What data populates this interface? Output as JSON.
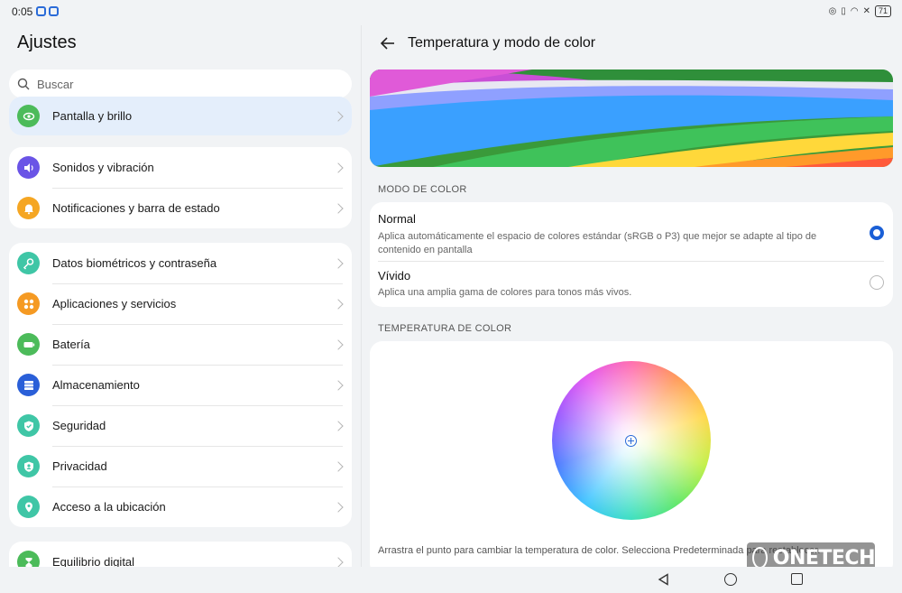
{
  "status_bar": {
    "time": "0:05",
    "battery": "71"
  },
  "left_pane": {
    "title": "Ajustes",
    "search": {
      "placeholder": "Buscar"
    },
    "selected_item": {
      "label": "Pantalla y brillo",
      "icon": "eye-icon",
      "color": "#4cbb5a"
    },
    "group1": [
      {
        "label": "Sonidos y vibración",
        "icon": "speaker-icon",
        "color": "#6a54e6"
      },
      {
        "label": "Notificaciones y barra de estado",
        "icon": "bell-icon",
        "color": "#f5a623"
      }
    ],
    "group2": [
      {
        "label": "Datos biométricos y contraseña",
        "icon": "key-icon",
        "color": "#3fc6a6"
      },
      {
        "label": "Aplicaciones y servicios",
        "icon": "apps-icon",
        "color": "#f59a23"
      },
      {
        "label": "Batería",
        "icon": "battery-icon",
        "color": "#4cbb5a"
      },
      {
        "label": "Almacenamiento",
        "icon": "storage-icon",
        "color": "#2a5fd8"
      },
      {
        "label": "Seguridad",
        "icon": "shield-icon",
        "color": "#3fc6a6"
      },
      {
        "label": "Privacidad",
        "icon": "privacy-icon",
        "color": "#3fc6a6"
      },
      {
        "label": "Acceso a la ubicación",
        "icon": "location-icon",
        "color": "#3fc6a6"
      }
    ],
    "group3": [
      {
        "label": "Equilibrio digital",
        "icon": "hourglass-icon",
        "color": "#4cbb5a"
      }
    ]
  },
  "right_pane": {
    "title": "Temperatura y modo de color",
    "color_mode_header": "MODO DE COLOR",
    "options": [
      {
        "title": "Normal",
        "description": "Aplica automáticamente el espacio de colores estándar (sRGB o P3) que mejor se adapte al tipo de contenido en pantalla",
        "selected": true
      },
      {
        "title": "Vívido",
        "description": "Aplica una amplia gama de colores para tonos más vivos.",
        "selected": false
      }
    ],
    "temperature_header": "TEMPERATURA DE COLOR",
    "hint": "Arrastra el punto para cambiar la temperatura de color. Selecciona Predeterminada para restablecer."
  },
  "watermark": "ONETECH",
  "accent_color": "#1a5fd6"
}
